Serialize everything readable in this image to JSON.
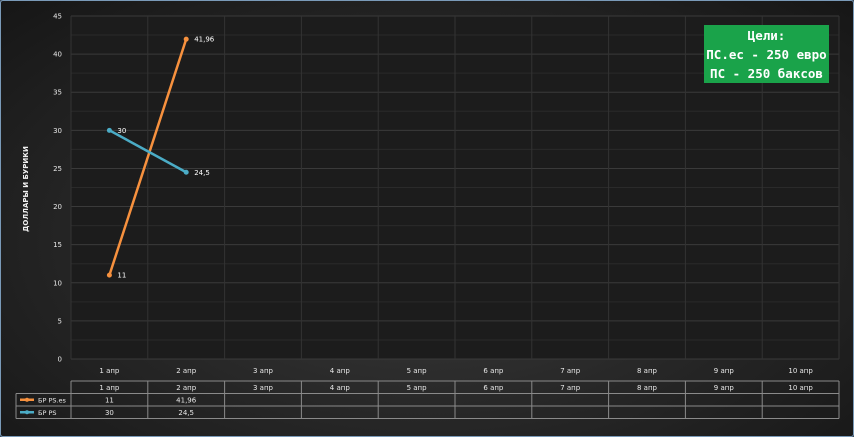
{
  "chart_data": {
    "type": "line",
    "ylabel": "ДОЛЛАРЫ И БУРИКИ",
    "xlabel": "",
    "ylim": [
      0,
      45
    ],
    "yticks": [
      0,
      5,
      10,
      15,
      20,
      25,
      30,
      35,
      40,
      45
    ],
    "categories": [
      "1 апр",
      "2 апр",
      "3 апр",
      "4 апр",
      "5 апр",
      "6 апр",
      "7 апр",
      "8 апр",
      "9 апр",
      "10 апр"
    ],
    "grid": true,
    "series": [
      {
        "name": "БР PS.es",
        "color": "#f7913e",
        "values": [
          11,
          41.96,
          null,
          null,
          null,
          null,
          null,
          null,
          null,
          null
        ],
        "labels": [
          "11",
          "41,96"
        ]
      },
      {
        "name": "БР PS",
        "color": "#4bacc6",
        "values": [
          30,
          24.5,
          null,
          null,
          null,
          null,
          null,
          null,
          null,
          null
        ],
        "labels": [
          "30",
          "24,5"
        ]
      }
    ]
  },
  "goals": {
    "line1": "Цели:",
    "line2": "ПС.ес - 250 евро",
    "line3": "ПС - 250 баксов"
  },
  "colors": {
    "goal_bg": "#1aa34a",
    "plot_bg": "#1c1c1c",
    "grid": "#333333",
    "axis_text": "#e8e8e8"
  }
}
